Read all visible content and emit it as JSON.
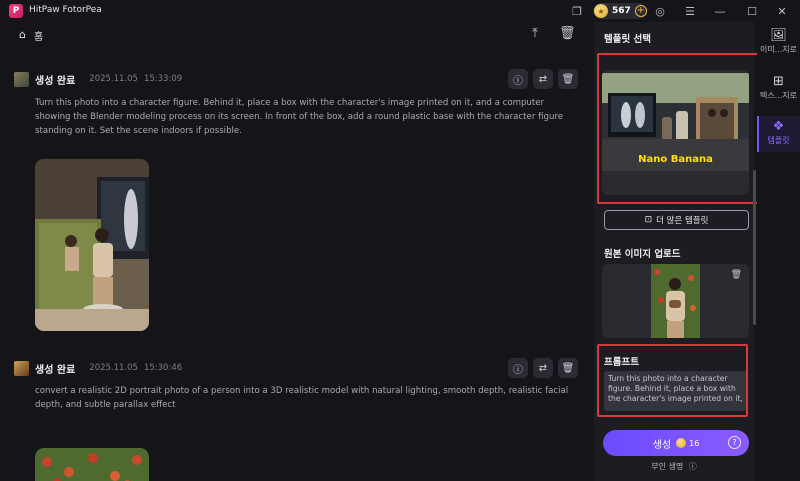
{
  "app": {
    "title": "HitPaw FotorPea",
    "credits": "567"
  },
  "header": {
    "home_label": "홈"
  },
  "entries": [
    {
      "title": "생성 완료",
      "date": "2025.11.05",
      "time": "15:33:09",
      "prompt": "Turn this photo into a character figure. Behind it, place a box with the character's image printed on it, and a computer showing the Blender modeling process on its screen. In front of the box, add a round plastic base with the character figure standing on it. Set the scene indoors if possible."
    },
    {
      "title": "생성 완료",
      "date": "2025.11.05",
      "time": "15:30:46",
      "prompt": "convert a realistic 2D portrait photo of a person into a 3D realistic model with natural lighting, smooth depth, realistic facial depth, and subtle parallax effect"
    }
  ],
  "panel": {
    "template_title": "템플릿 선택",
    "template_image_text": "Nano Banana",
    "more_templates": "더 많은 템플릿",
    "upload_title": "원본 이미지 업로드",
    "prompt_title": "프롬프트",
    "prompt_value": "Turn this photo into a character figure. Behind it, place a box with the character's image printed on it,",
    "generate_label": "생성",
    "generate_cost": "16",
    "negative_prompt": "부인 생명"
  },
  "toolbar": {
    "items": [
      {
        "label": "이미...지로",
        "icon": "image-icon"
      },
      {
        "label": "텍스...지로",
        "icon": "text-image-icon"
      },
      {
        "label": "템플릿",
        "icon": "template-icon"
      }
    ]
  },
  "colors": {
    "accent": "#7a55ff",
    "highlight_box": "#d63b3b",
    "banana_text": "#ffe100"
  }
}
